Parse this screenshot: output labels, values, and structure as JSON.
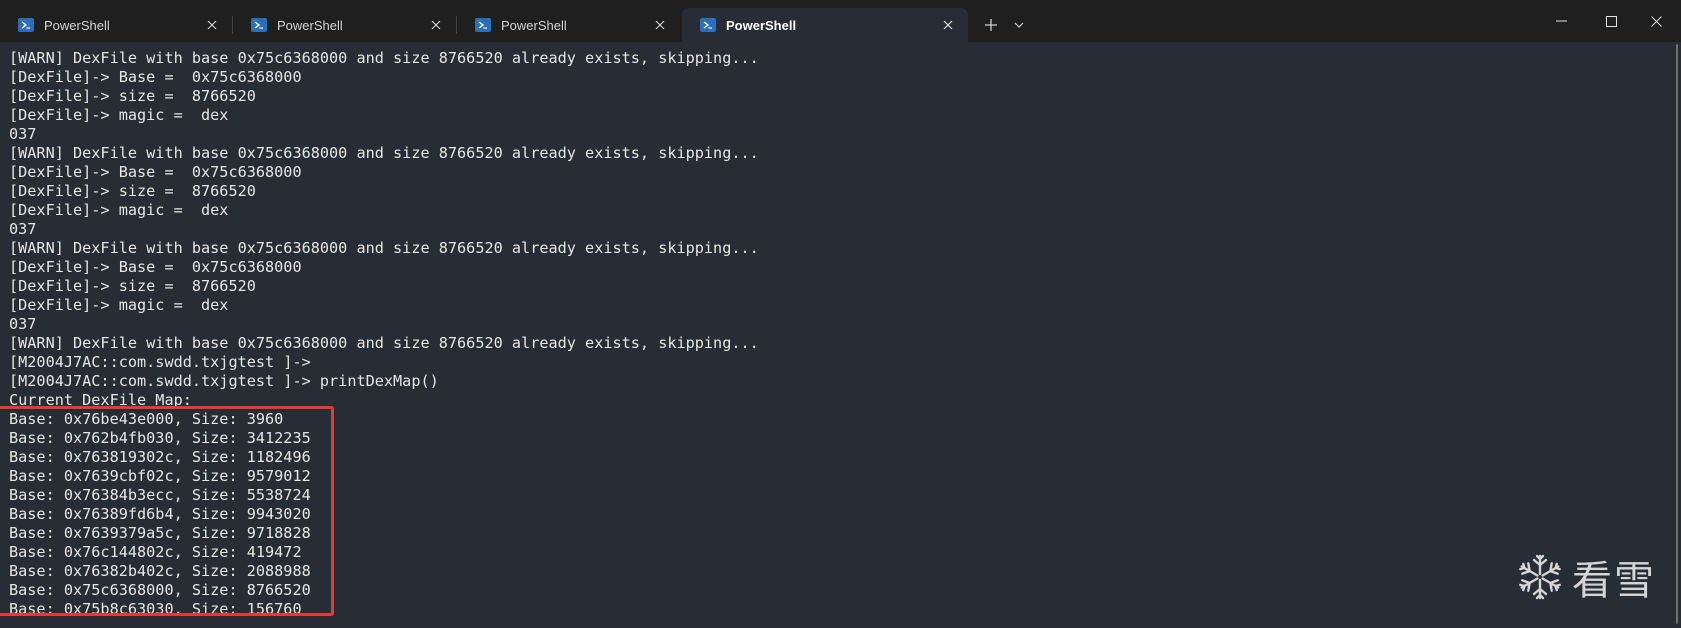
{
  "window": {
    "tabs": [
      {
        "label": "PowerShell",
        "active": false
      },
      {
        "label": "PowerShell",
        "active": false
      },
      {
        "label": "PowerShell",
        "active": false
      },
      {
        "label": "PowerShell",
        "active": true
      }
    ],
    "new_tab_symbol": "+",
    "icons": {
      "tab": "powershell-icon",
      "close": "close-icon",
      "new_tab": "plus-icon",
      "dropdown": "chevron-down-icon",
      "minimize": "minimize-icon",
      "maximize": "maximize-icon",
      "close_window": "close-icon"
    }
  },
  "terminal": {
    "lines": [
      "[WARN] DexFile with base 0x75c6368000 and size 8766520 already exists, skipping...",
      "[DexFile]-> Base =  0x75c6368000",
      "[DexFile]-> size =  8766520",
      "[DexFile]-> magic =  dex",
      "037",
      "[WARN] DexFile with base 0x75c6368000 and size 8766520 already exists, skipping...",
      "[DexFile]-> Base =  0x75c6368000",
      "[DexFile]-> size =  8766520",
      "[DexFile]-> magic =  dex",
      "037",
      "[WARN] DexFile with base 0x75c6368000 and size 8766520 already exists, skipping...",
      "[DexFile]-> Base =  0x75c6368000",
      "[DexFile]-> size =  8766520",
      "[DexFile]-> magic =  dex",
      "037",
      "[WARN] DexFile with base 0x75c6368000 and size 8766520 already exists, skipping...",
      "[M2004J7AC::com.swdd.txjgtest ]->",
      "[M2004J7AC::com.swdd.txjgtest ]-> printDexMap()",
      "Current DexFile Map:",
      "Base: 0x76be43e000, Size: 3960",
      "Base: 0x762b4fb030, Size: 3412235",
      "Base: 0x763819302c, Size: 1182496",
      "Base: 0x7639cbf02c, Size: 9579012",
      "Base: 0x76384b3ecc, Size: 5538724",
      "Base: 0x76389fd6b4, Size: 9943020",
      "Base: 0x7639379a5c, Size: 9718828",
      "Base: 0x76c144802c, Size: 419472",
      "Base: 0x76382b402c, Size: 2088988",
      "Base: 0x75c6368000, Size: 8766520",
      "Base: 0x75b8c63030, Size: 156760"
    ],
    "highlight_color": "#e53935",
    "background_color": "#282c34"
  },
  "watermark": {
    "text": "看雪",
    "icon": "snowflake-icon"
  }
}
